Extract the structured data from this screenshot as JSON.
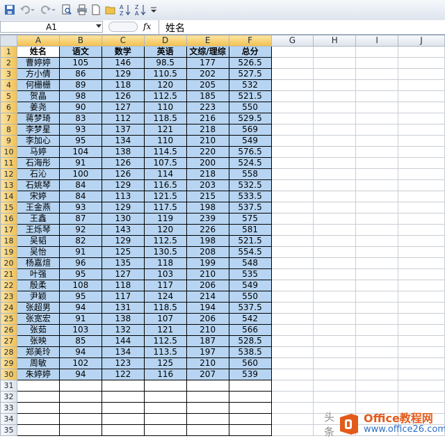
{
  "formula_bar": {
    "name_box": "A1",
    "fx": "fx",
    "content": "姓名"
  },
  "columns": [
    "A",
    "B",
    "C",
    "D",
    "E",
    "F",
    "G",
    "H",
    "I",
    "J"
  ],
  "rows": [
    [
      "姓名",
      "语文",
      "数学",
      "英语",
      "文综/理综",
      "总分"
    ],
    [
      "曹婷婷",
      "105",
      "146",
      "98.5",
      "177",
      "526.5"
    ],
    [
      "方小倩",
      "86",
      "129",
      "110.5",
      "202",
      "527.5"
    ],
    [
      "何栅栅",
      "89",
      "118",
      "120",
      "205",
      "532"
    ],
    [
      "贺晶",
      "98",
      "126",
      "112.5",
      "185",
      "521.5"
    ],
    [
      "姜尧",
      "90",
      "127",
      "110",
      "223",
      "550"
    ],
    [
      "蒋梦琦",
      "83",
      "112",
      "118.5",
      "216",
      "529.5"
    ],
    [
      "李梦星",
      "93",
      "137",
      "121",
      "218",
      "569"
    ],
    [
      "李加心",
      "95",
      "134",
      "110",
      "210",
      "549"
    ],
    [
      "马婷",
      "104",
      "138",
      "114.5",
      "220",
      "576.5"
    ],
    [
      "石海彤",
      "91",
      "126",
      "107.5",
      "200",
      "524.5"
    ],
    [
      "石沁",
      "100",
      "126",
      "114",
      "218",
      "558"
    ],
    [
      "石姚琴",
      "84",
      "129",
      "116.5",
      "203",
      "532.5"
    ],
    [
      "宋婷",
      "84",
      "113",
      "121.5",
      "215",
      "533.5"
    ],
    [
      "王金燕",
      "93",
      "129",
      "117.5",
      "198",
      "537.5"
    ],
    [
      "王鑫",
      "87",
      "130",
      "119",
      "239",
      "575"
    ],
    [
      "王烁琴",
      "92",
      "143",
      "120",
      "226",
      "581"
    ],
    [
      "吴韬",
      "82",
      "129",
      "112.5",
      "198",
      "521.5"
    ],
    [
      "吴怡",
      "91",
      "125",
      "130.5",
      "208",
      "554.5"
    ],
    [
      "杨嘉煊",
      "96",
      "135",
      "118",
      "199",
      "548"
    ],
    [
      "叶强",
      "95",
      "127",
      "103",
      "210",
      "535"
    ],
    [
      "殷柔",
      "108",
      "118",
      "117",
      "206",
      "549"
    ],
    [
      "尹颖",
      "95",
      "117",
      "124",
      "214",
      "550"
    ],
    [
      "张超男",
      "94",
      "131",
      "118.5",
      "194",
      "537.5"
    ],
    [
      "张宽宏",
      "91",
      "138",
      "107",
      "206",
      "542"
    ],
    [
      "张茹",
      "103",
      "132",
      "121",
      "210",
      "566"
    ],
    [
      "张映",
      "85",
      "144",
      "112.5",
      "187",
      "528.5"
    ],
    [
      "郑美玲",
      "94",
      "134",
      "113.5",
      "197",
      "538.5"
    ],
    [
      "周敏",
      "102",
      "123",
      "125",
      "210",
      "560"
    ],
    [
      "朱婷婷",
      "94",
      "122",
      "116",
      "207",
      "539"
    ]
  ],
  "row_numbers": [
    "1",
    "2",
    "3",
    "4",
    "5",
    "6",
    "7",
    "8",
    "9",
    "10",
    "11",
    "12",
    "13",
    "14",
    "15",
    "16",
    "17",
    "18",
    "19",
    "20",
    "21",
    "22",
    "23",
    "24",
    "25",
    "26",
    "27",
    "28",
    "29",
    "30",
    "31",
    "32",
    "33",
    "34",
    "35"
  ],
  "watermark": {
    "side_text": "头条",
    "title": "Office教程网",
    "url": "www.office26.com"
  },
  "colors": {
    "selection": "#b7d5f2",
    "header_selected": "#f2c04f",
    "logo_orange": "#e35b1b"
  }
}
